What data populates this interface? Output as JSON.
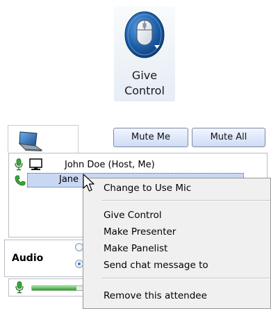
{
  "give_control": {
    "label_line1": "Give",
    "label_line2": "Control",
    "icon": "mouse-icon"
  },
  "toolbar": {
    "tab_icon": "computer-icon",
    "mute_me_label": "Mute Me",
    "mute_all_label": "Mute All"
  },
  "attendees": [
    {
      "name": "John Doe (Host, Me)",
      "icons": [
        "microphone-icon",
        "monitor-icon"
      ],
      "selected": false
    },
    {
      "name": "Jane",
      "icons": [
        "phone-icon"
      ],
      "selected": true
    }
  ],
  "audio": {
    "label": "Audio",
    "selected_option": 2,
    "level": 0.8
  },
  "context_menu": {
    "items": [
      "Change to Use Mic",
      "Give Control",
      "Make Presenter",
      "Make Panelist",
      "Send chat message to",
      "Remove this attendee"
    ]
  },
  "colors": {
    "selection": "#c8d8f2",
    "button": "#dfe8fb",
    "menu_background": "#f0f0f0",
    "icon_blue": "#1d5ea8",
    "mic_green": "#3aa53a"
  }
}
